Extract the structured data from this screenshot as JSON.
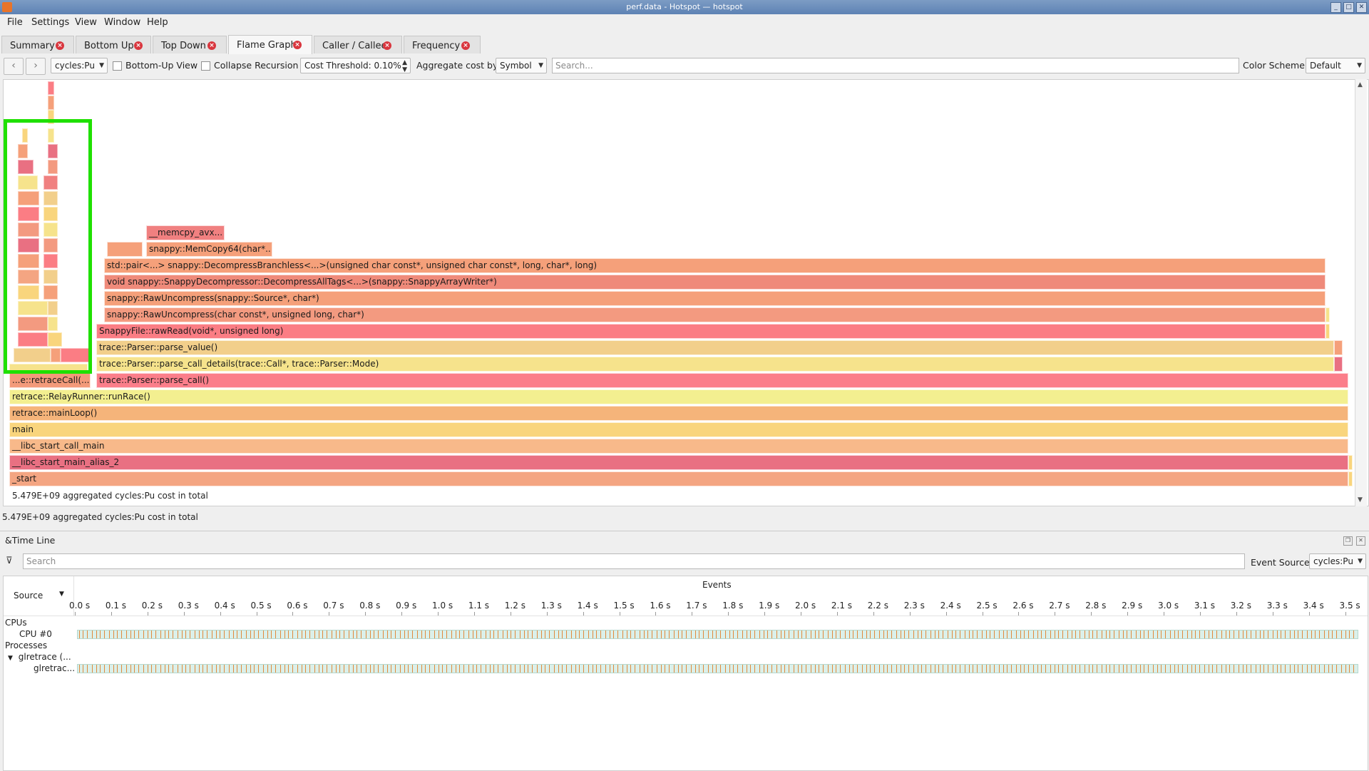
{
  "window": {
    "title": "perf.data - Hotspot — hotspot"
  },
  "menu": [
    "File",
    "Settings",
    "View",
    "Window",
    "Help"
  ],
  "tabs": [
    {
      "label": "Summary",
      "active": false
    },
    {
      "label": "Bottom Up",
      "active": false
    },
    {
      "label": "Top Down",
      "active": false
    },
    {
      "label": "Flame Graph",
      "active": true
    },
    {
      "label": "Caller / Callee",
      "active": false
    },
    {
      "label": "Frequency",
      "active": false
    }
  ],
  "toolbar": {
    "back_icon": "arrow-left-icon",
    "forward_icon": "arrow-right-icon",
    "cost_type": "cycles:Pu",
    "bottom_up_label": "Bottom-Up View",
    "bottom_up_checked": false,
    "collapse_recursion_label": "Collapse Recursion",
    "collapse_recursion_checked": false,
    "cost_threshold": "Cost Threshold: 0.10%",
    "aggregate_label": "Aggregate cost by:",
    "aggregate_value": "Symbol",
    "search_placeholder": "Search...",
    "color_scheme_label": "Color Scheme:",
    "color_scheme_value": "Default"
  },
  "flame_graph": {
    "frames": [
      {
        "label": "__memcpy_avx...",
        "color": "#f08080"
      },
      {
        "label": "snappy::MemCopy64(char*...)",
        "color": "#f5a07a"
      },
      {
        "label": "std::pair<...> snappy::DecompressBranchless<...>(unsigned char const*, unsigned char const*, long, char*, long)",
        "color": "#f5a07a"
      },
      {
        "label": "void snappy::SnappyDecompressor::DecompressAllTags<...>(snappy::SnappyArrayWriter*)",
        "color": "#ef8a7a"
      },
      {
        "label": "snappy::RawUncompress(snappy::Source*, char*)",
        "color": "#f5a07a"
      },
      {
        "label": "snappy::RawUncompress(char const*, unsigned long, char*)",
        "color": "#f39a80"
      },
      {
        "label": "SnappyFile::rawRead(void*, unsigned long)",
        "color": "#fb7d84"
      },
      {
        "label": "trace::Parser::parse_value()",
        "color": "#f2cf8b"
      },
      {
        "label": "trace::Parser::parse_call_details(trace::Call*, trace::Parser::Mode)",
        "color": "#f6e38c"
      },
      {
        "label": "...e::retraceCall(...)",
        "color": "#f39a7a"
      },
      {
        "label": "trace::Parser::parse_call()",
        "color": "#fb7e8a"
      },
      {
        "label": "retrace::RelayRunner::runRace()",
        "color": "#f3ef90"
      },
      {
        "label": "retrace::mainLoop()",
        "color": "#f5b47a"
      },
      {
        "label": "main",
        "color": "#f9d57d"
      },
      {
        "label": "__libc_start_call_main",
        "color": "#f8b98a"
      },
      {
        "label": "__libc_start_main_alias_2",
        "color": "#e97082"
      },
      {
        "label": "_start",
        "color": "#f4a582"
      }
    ],
    "total_text": "5.479E+09 aggregated cycles:Pu cost in total"
  },
  "status_text": "5.479E+09 aggregated cycles:Pu cost in total",
  "timeline": {
    "title": "&Time Line",
    "search_placeholder": "Search",
    "filter_icon": "filter-icon",
    "event_source_label": "Event Source:",
    "event_source_value": "cycles:Pu",
    "source_header": "Source",
    "events_header": "Events",
    "ticks": [
      "0.0 s",
      "0.1 s",
      "0.2 s",
      "0.3 s",
      "0.4 s",
      "0.5 s",
      "0.6 s",
      "0.7 s",
      "0.8 s",
      "0.9 s",
      "1.0 s",
      "1.1 s",
      "1.2 s",
      "1.3 s",
      "1.4 s",
      "1.5 s",
      "1.6 s",
      "1.7 s",
      "1.8 s",
      "1.9 s",
      "2.0 s",
      "2.1 s",
      "2.2 s",
      "2.3 s",
      "2.4 s",
      "2.5 s",
      "2.6 s",
      "2.7 s",
      "2.8 s",
      "2.9 s",
      "3.0 s",
      "3.1 s",
      "3.2 s",
      "3.3 s",
      "3.4 s",
      "3.5 s"
    ],
    "rows": {
      "cpus": "CPUs",
      "cpu0": "CPU #0",
      "processes": "Processes",
      "process": "glretrace (...",
      "thread": "glretrac..."
    }
  }
}
